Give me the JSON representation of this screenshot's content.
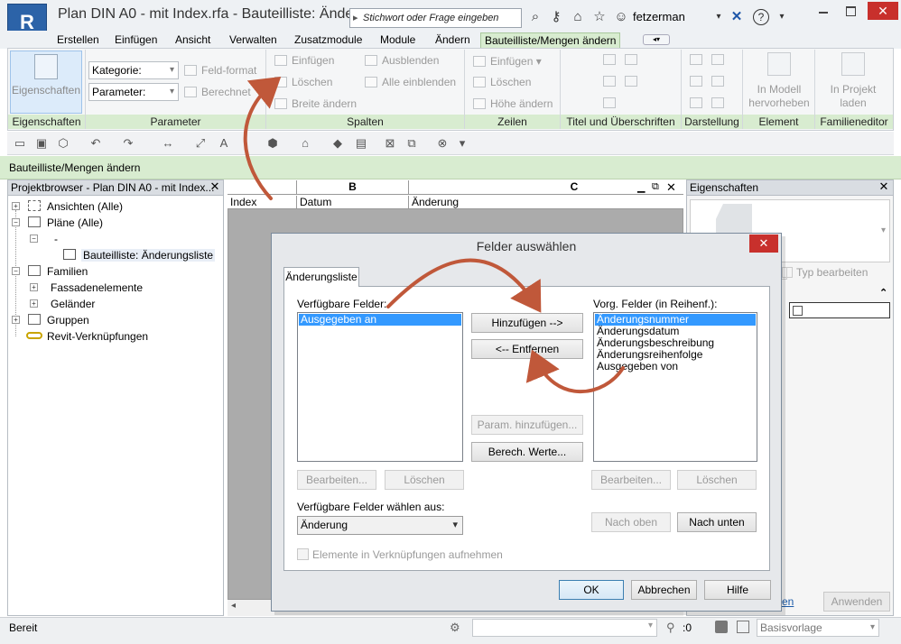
{
  "window": {
    "title": "Plan DIN A0 - mit Index.rfa - Bauteilliste: Änder...",
    "app_logo_letter": "R",
    "app_logo_sub": "A",
    "search_placeholder": "Stichwort oder Frage eingeben",
    "user": "fetzerman",
    "close_glyph": "✕",
    "help_glyph": "?"
  },
  "ribbon_tabs": [
    "Erstellen",
    "Einfügen",
    "Ansicht",
    "Verwalten",
    "Zusatzmodule",
    "Module",
    "Ändern",
    "Bauteilliste/Mengen ändern"
  ],
  "ribbon": {
    "eigenschaften_button": "Eigenschaften",
    "groups": {
      "eigenschaften": "Eigenschaften",
      "parameter": "Parameter",
      "spalten": "Spalten",
      "zeilen": "Zeilen",
      "titel": "Titel und Überschriften",
      "darstellung": "Darstellung",
      "element": "Element",
      "familieneditor": "Familieneditor"
    },
    "parameter": {
      "kategorie": "Kategorie:",
      "parameter": "Parameter:",
      "feld_format": "Feld-format",
      "berechnet": "Berechnet"
    },
    "spalten": {
      "einfuegen": "Einfügen",
      "loeschen": "Löschen",
      "breite": "Breite ändern",
      "ausblenden": "Ausblenden",
      "alle_einblenden": "Alle  einblenden"
    },
    "zeilen": {
      "einfuegen": "Einfügen",
      "loeschen": "Löschen",
      "hoehe": "Höhe ändern"
    },
    "element": {
      "hervorheben": "In Modell\nhervorheben"
    },
    "familieneditor": {
      "laden": "In Projekt\nladen"
    }
  },
  "context_label": "Bauteilliste/Mengen ändern",
  "project_browser": {
    "title": "Projektbrowser - Plan DIN A0 - mit Index...",
    "items": [
      {
        "label": "Ansichten (Alle)",
        "level": 0,
        "toggle": "+"
      },
      {
        "label": "Pläne (Alle)",
        "level": 0,
        "toggle": "−"
      },
      {
        "label": "-",
        "level": 1,
        "toggle": "−"
      },
      {
        "label": "Bauteilliste: Änderungsliste",
        "level": 2,
        "toggle": "",
        "selected": true
      },
      {
        "label": "Familien",
        "level": 0,
        "toggle": "−"
      },
      {
        "label": "Fassadenelemente",
        "level": 1,
        "toggle": "+"
      },
      {
        "label": "Geländer",
        "level": 1,
        "toggle": "+"
      },
      {
        "label": "Gruppen",
        "level": 0,
        "toggle": "+"
      },
      {
        "label": "Revit-Verknüpfungen",
        "level": 0,
        "toggle": ""
      }
    ]
  },
  "schedule": {
    "columns": [
      "B",
      "C"
    ],
    "fields": [
      "Index",
      "Datum",
      "Änderung"
    ]
  },
  "properties": {
    "title": "Eigenschaften",
    "typ_bearbeiten": "Typ bearbeiten",
    "link_fragment": "en",
    "anwenden": "Anwenden"
  },
  "dialog": {
    "title": "Felder auswählen",
    "tab": "Änderungsliste",
    "available_label": "Verfügbare Felder:",
    "available_items": [
      "Ausgegeben an"
    ],
    "selected_label": "Vorg. Felder (in Reihenf.):",
    "selected_items": [
      "Änderungsnummer",
      "Änderungsdatum",
      "Änderungsbeschreibung",
      "Änderungsreihenfolge",
      "Ausgegeben von"
    ],
    "add_button": "Hinzufügen -->",
    "remove_button": "<-- Entfernen",
    "param_button": "Param. hinzufügen...",
    "calc_button": "Berech. Werte...",
    "edit_left": "Bearbeiten...",
    "delete_left": "Löschen",
    "edit_right": "Bearbeiten...",
    "delete_right": "Löschen",
    "select_from_label": "Verfügbare Felder wählen aus:",
    "select_from_value": "Änderung",
    "up_button": "Nach oben",
    "down_button": "Nach unten",
    "include_links": "Elemente in Verknüpfungen aufnehmen",
    "ok": "OK",
    "cancel": "Abbrechen",
    "help": "Hilfe"
  },
  "status": {
    "text": "Bereit",
    "filter_count": ":0",
    "template": "Basisvorlage"
  },
  "colors": {
    "accent_green": "#d8ecd0",
    "selection_blue": "#3399ff",
    "annotation_arrow": "#c0583a",
    "close_red": "#c8302c"
  }
}
